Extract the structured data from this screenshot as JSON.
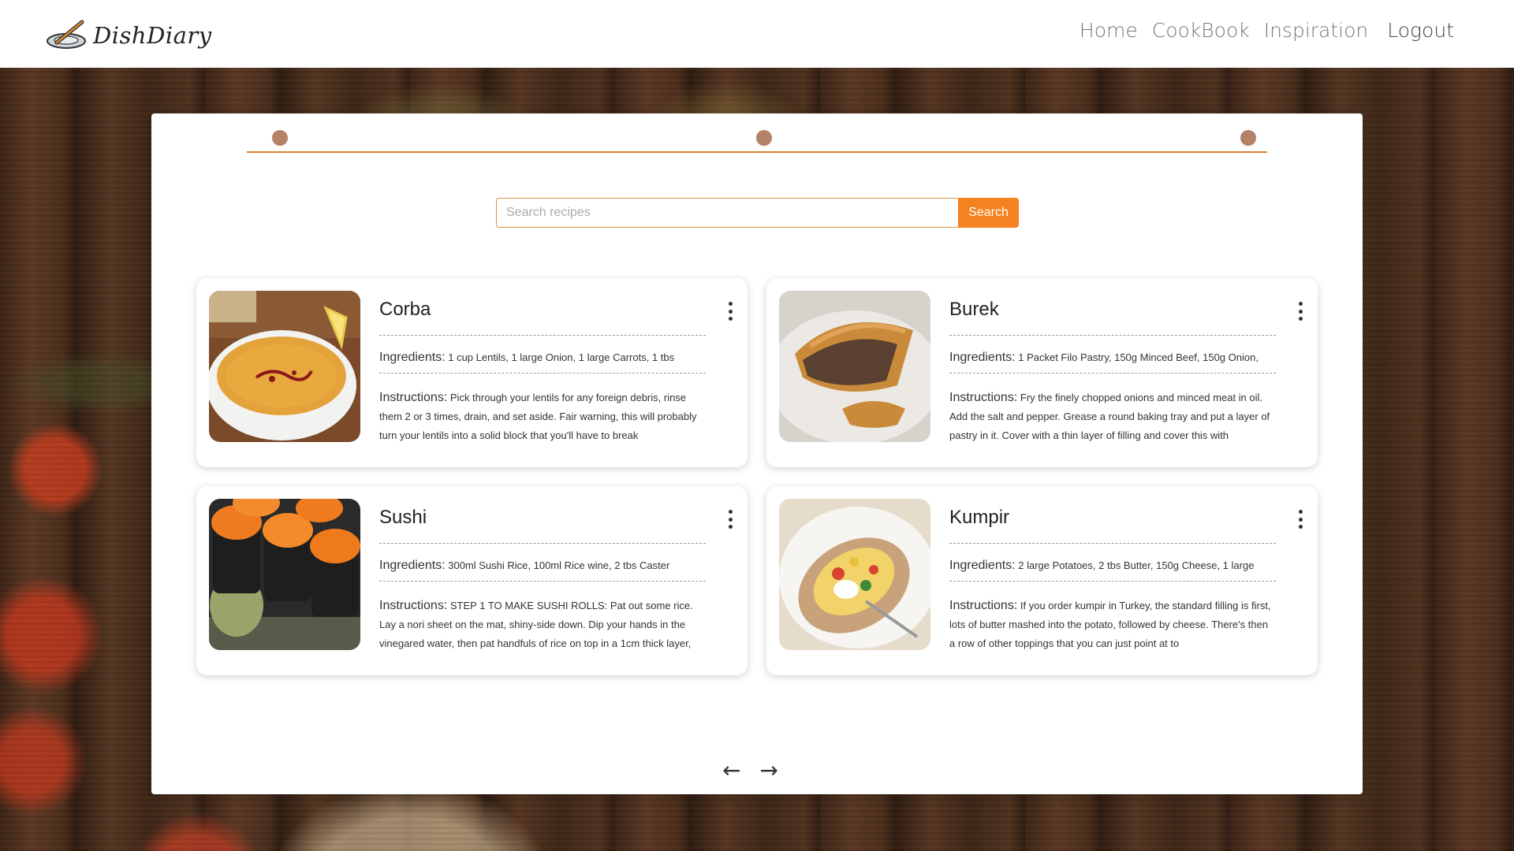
{
  "brand": {
    "name": "DishDiary"
  },
  "nav": {
    "items": [
      "Home",
      "CookBook",
      "Inspiration"
    ],
    "logout": "Logout"
  },
  "search": {
    "placeholder": "Search recipes",
    "button": "Search"
  },
  "stepper": {
    "steps": 3,
    "active_color": "#b48266",
    "line_color": "#d9822b"
  },
  "labels": {
    "ingredients": "Ingredients:",
    "instructions": "Instructions:"
  },
  "recipes": [
    {
      "title": "Corba",
      "ingredients": "1 cup Lentils, 1 large Onion, 1 large Carrots, 1 tbs",
      "instructions": "Pick through your lentils for any foreign debris, rinse them 2 or 3 times, drain, and set aside. Fair warning, this will probably turn your lentils into a solid block that you'll have to break"
    },
    {
      "title": "Burek",
      "ingredients": "1 Packet Filo Pastry, 150g Minced Beef, 150g Onion,",
      "instructions": "Fry the finely chopped onions and minced meat in oil. Add the salt and pepper. Grease a round baking tray and put a layer of pastry in it. Cover with a thin layer of filling and cover this with"
    },
    {
      "title": "Sushi",
      "ingredients": "300ml Sushi Rice, 100ml Rice wine, 2 tbs Caster",
      "instructions": "STEP 1 TO MAKE SUSHI ROLLS: Pat out some rice. Lay a nori sheet on the mat, shiny-side down. Dip your hands in the vinegared water, then pat handfuls of rice on top in a 1cm thick layer,"
    },
    {
      "title": "Kumpir",
      "ingredients": "2 large Potatoes, 2 tbs Butter, 150g Cheese, 1 large",
      "instructions": "If you order kumpir in Turkey, the standard filling is first, lots of butter mashed into the potato, followed by cheese. There's then a row of other toppings that you can just point at to"
    }
  ],
  "pager": {
    "prev_icon": "arrow-left-icon",
    "next_icon": "arrow-right-icon",
    "prev": "←",
    "next": "→"
  },
  "colors": {
    "accent": "#f58220",
    "accent_border": "#e0953c"
  }
}
